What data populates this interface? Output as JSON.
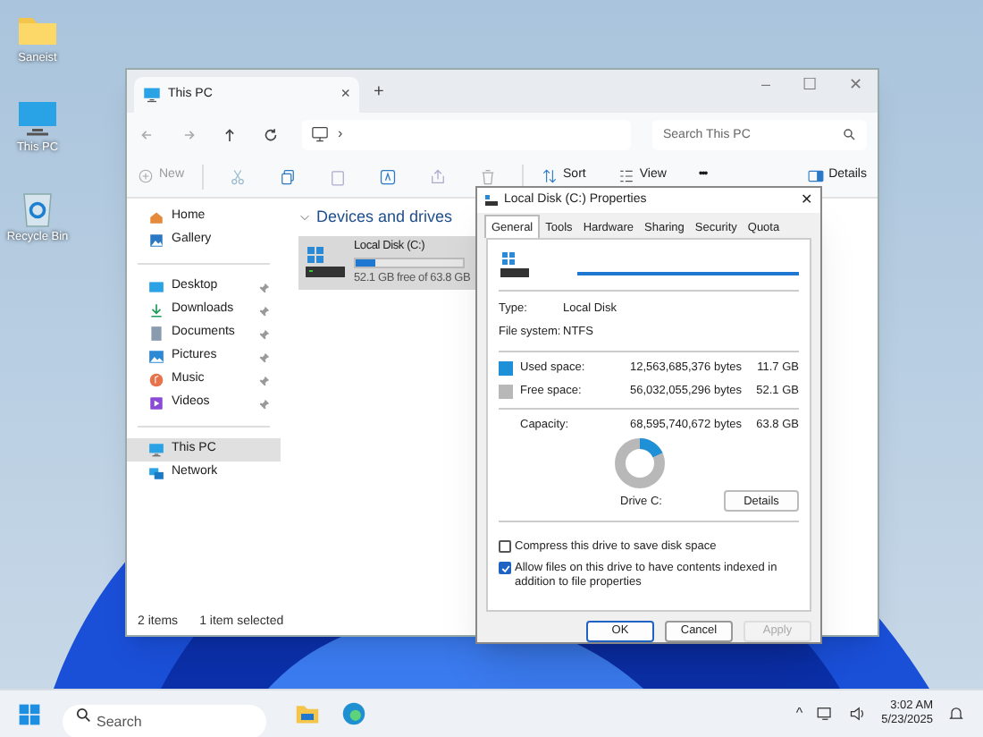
{
  "desktop_icons": [
    {
      "kind": "folder",
      "label": "Saneist"
    },
    {
      "kind": "pc",
      "label": "This PC"
    },
    {
      "kind": "bin",
      "label": "Recycle Bin"
    }
  ],
  "explorer": {
    "tab": {
      "title": "This PC",
      "close": "×"
    },
    "new_tab": "+",
    "window_controls": [
      "–",
      "☐",
      "✕"
    ],
    "address_sep": "›",
    "search": {
      "placeholder": "Search This PC"
    },
    "toolbar": {
      "new": "New",
      "sort": "Sort",
      "view": "View",
      "more": "•••",
      "details": "Details"
    },
    "sidebar": [
      {
        "label": "Home",
        "pinned": false,
        "selected": false
      },
      {
        "label": "Gallery",
        "pinned": false,
        "selected": false
      },
      {
        "label": "Desktop",
        "pinned": true,
        "selected": false
      },
      {
        "label": "Downloads",
        "pinned": true,
        "selected": false
      },
      {
        "label": "Documents",
        "pinned": true,
        "selected": false
      },
      {
        "label": "Pictures",
        "pinned": true,
        "selected": false
      },
      {
        "label": "Music",
        "pinned": true,
        "selected": false
      },
      {
        "label": "Videos",
        "pinned": true,
        "selected": false
      },
      {
        "label": "This PC",
        "pinned": false,
        "selected": true
      },
      {
        "label": "Network",
        "pinned": false,
        "selected": false
      }
    ],
    "section": "Devices and drives",
    "drive": {
      "name": "Local Disk (C:)",
      "level": 0.18,
      "free": "52.1 GB free of 63.8 GB",
      "selected": true
    },
    "status": [
      "2 items",
      "1 item selected"
    ]
  },
  "dialog": {
    "title": "Local Disk (C:) Properties",
    "close": "✕",
    "tabs": [
      {
        "label": "General",
        "selected": true
      },
      {
        "label": "Tools",
        "selected": false
      },
      {
        "label": "Hardware",
        "selected": false
      },
      {
        "label": "Sharing",
        "selected": false
      },
      {
        "label": "Security",
        "selected": false
      },
      {
        "label": "Quota",
        "selected": false
      }
    ],
    "info": [
      {
        "label": "Type:",
        "value": "Local Disk"
      },
      {
        "label": "File system:",
        "value": "NTFS"
      }
    ],
    "space": [
      {
        "label": "Used space:",
        "bytes": "12,563,685,376 bytes",
        "size": "11.7 GB",
        "color": "#1e90d8"
      },
      {
        "label": "Free space:",
        "bytes": "56,032,055,296 bytes",
        "size": "52.1 GB",
        "color": "#b8b8b8"
      }
    ],
    "capacity": {
      "label": "Capacity:",
      "bytes": "68,595,740,672 bytes",
      "size": "63.8 GB"
    },
    "usage": {
      "level": 0.18
    },
    "drive_label": "Drive C:",
    "details_button": "Details",
    "options": [
      {
        "label": "Compress this drive to save disk space",
        "checked": false
      },
      {
        "label": "Allow files on this drive to have contents indexed in addition to file properties",
        "checked": true
      }
    ],
    "buttons": [
      {
        "label": "OK",
        "kind": "default"
      },
      {
        "label": "Cancel",
        "kind": "normal"
      },
      {
        "label": "Apply",
        "kind": "disabled"
      }
    ]
  },
  "taskbar": {
    "search": {
      "placeholder": "Search"
    },
    "time": "3:02 AM",
    "date": "5/23/2025",
    "tray_caret": "^"
  }
}
